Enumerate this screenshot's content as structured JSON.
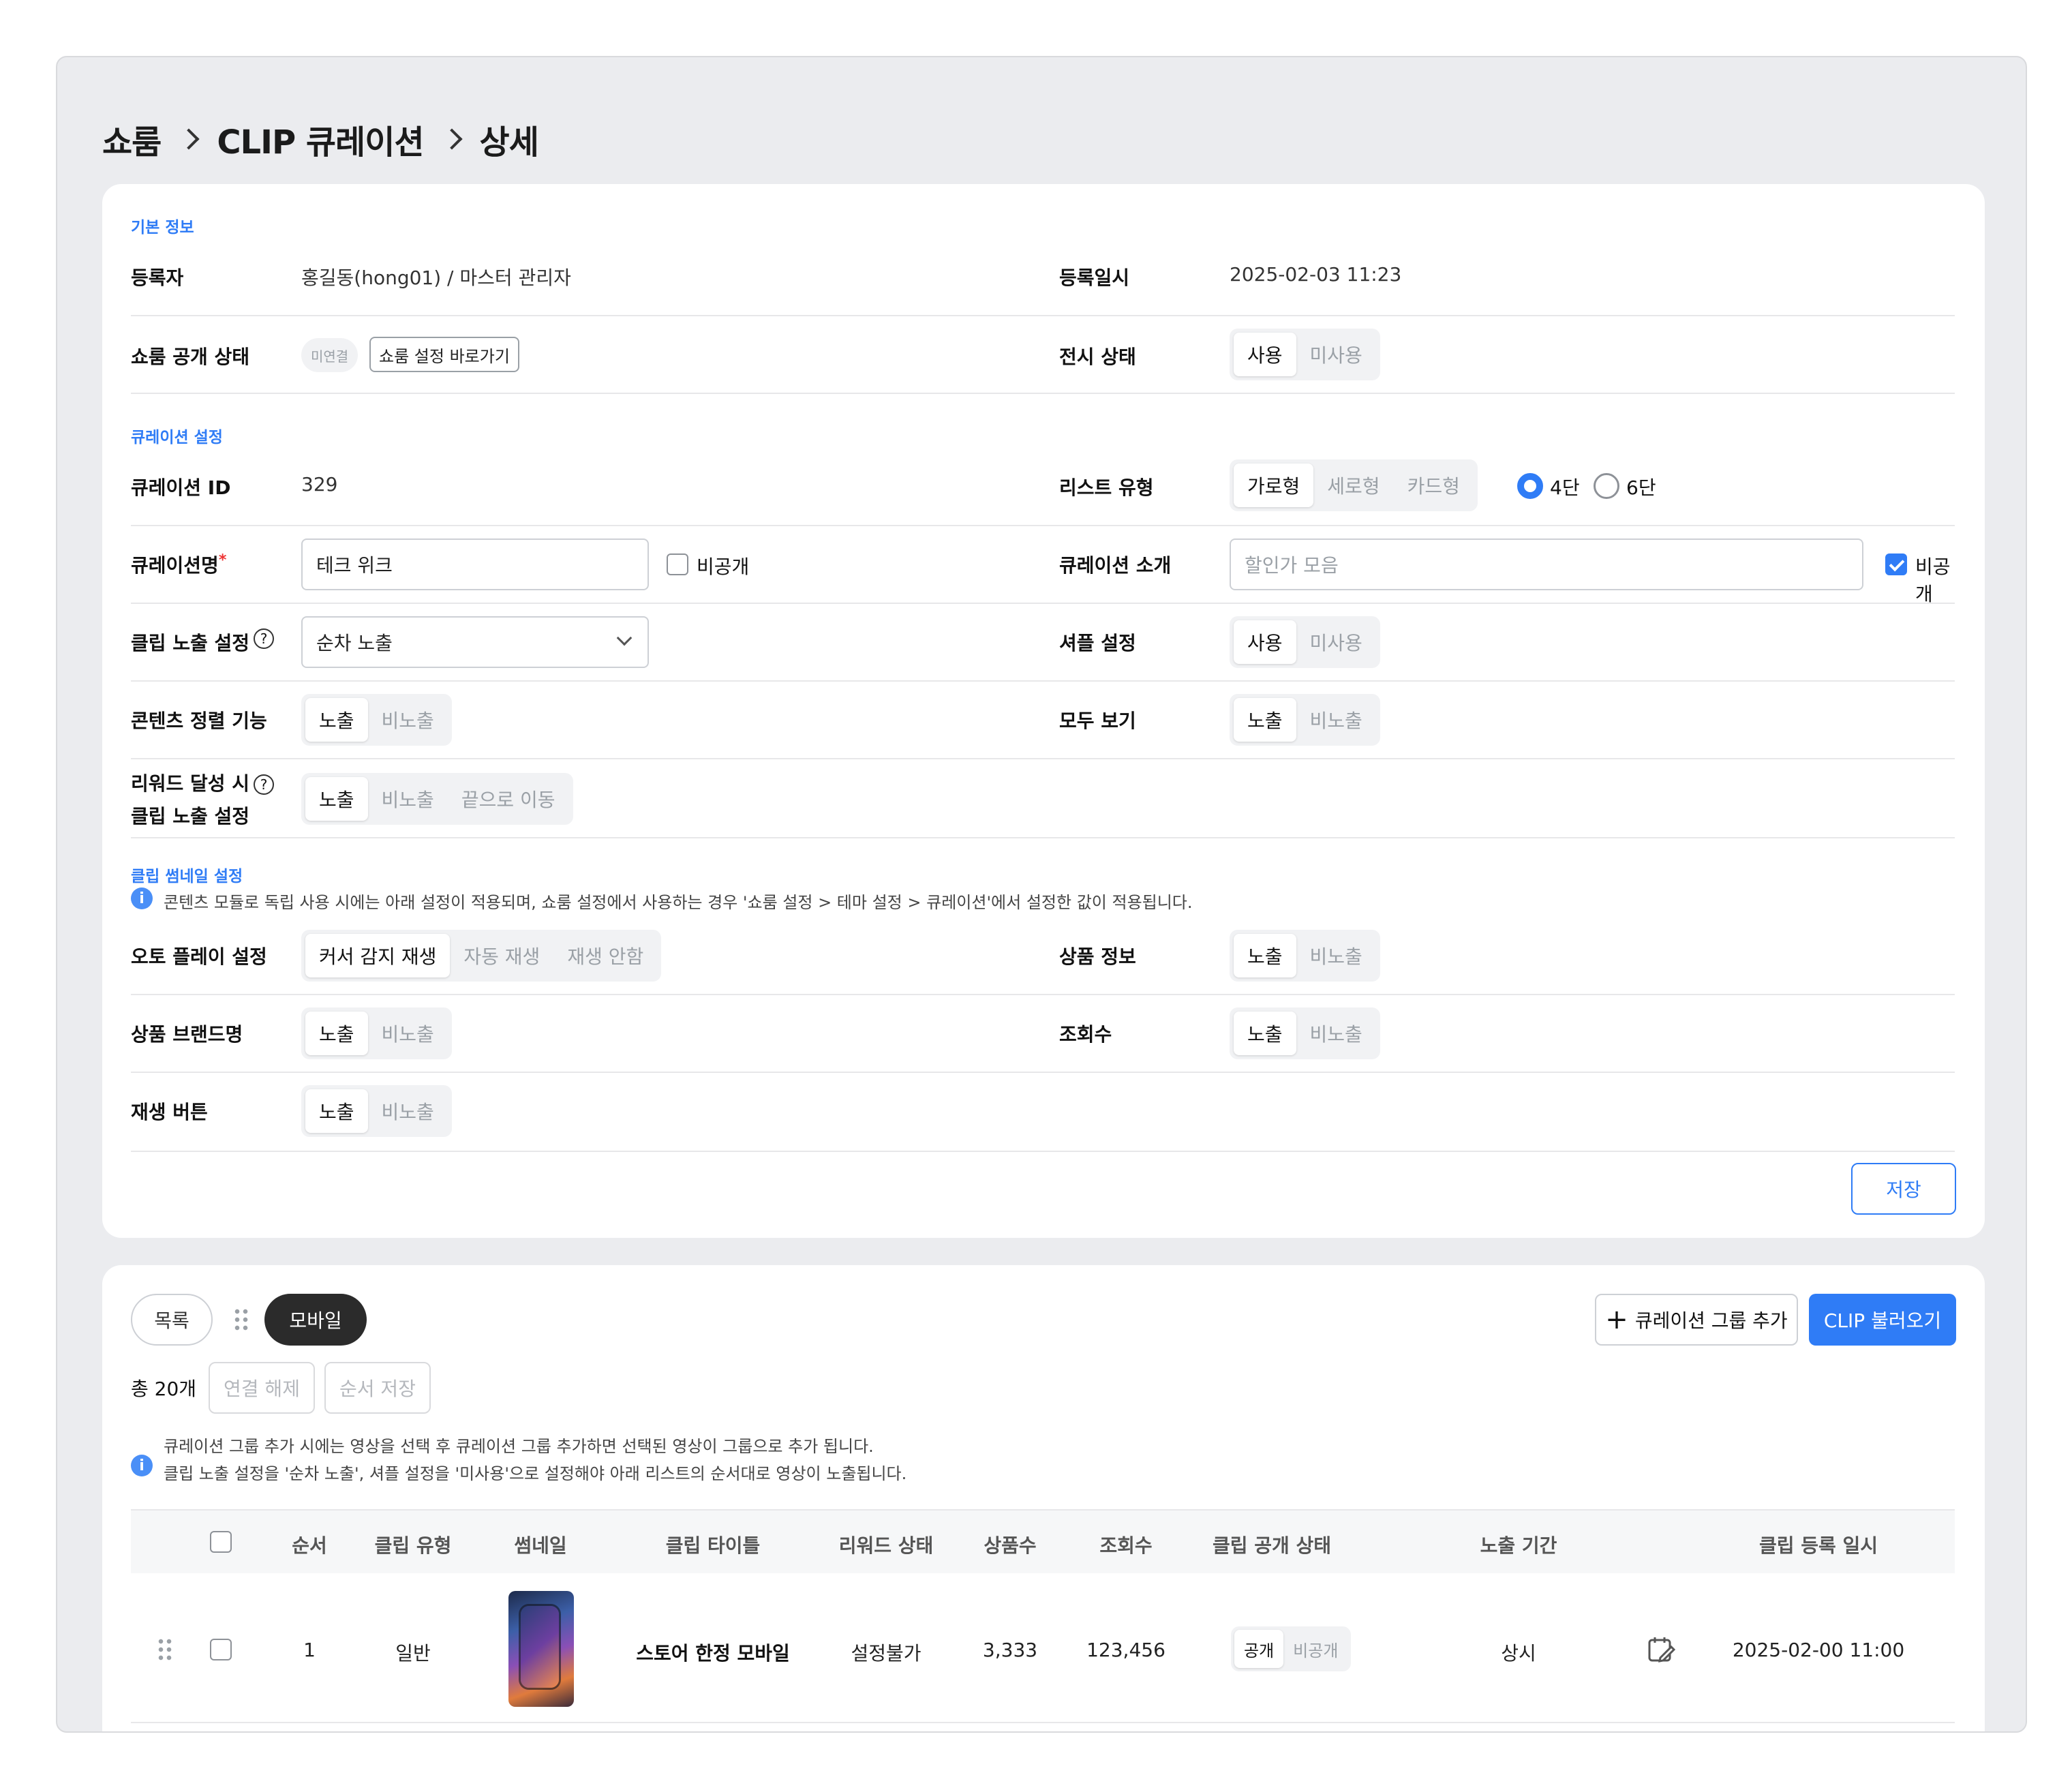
{
  "breadcrumb": {
    "items": [
      "쇼룸",
      "CLIP 큐레이션",
      "상세"
    ]
  },
  "basic": {
    "title": "기본 정보",
    "registrant_label": "등록자",
    "registrant_value": "홍길동(hong01) / 마스터 관리자",
    "regdate_label": "등록일시",
    "regdate_value": "2025-02-03 11:23",
    "showroom_status_label": "쇼룸 공개 상태",
    "showroom_status_badge": "미연결",
    "showroom_settings_link": "쇼룸 설정 바로가기",
    "display_status_label": "전시 상태",
    "display_status_options": [
      "사용",
      "미사용"
    ]
  },
  "curation": {
    "title": "큐레이션 설정",
    "id_label": "큐레이션 ID",
    "id_value": "329",
    "list_type_label": "리스트 유형",
    "list_type_options": [
      "가로형",
      "세로형",
      "카드형"
    ],
    "columns_options": [
      "4단",
      "6단"
    ],
    "columns_selected": "4단",
    "name_label": "큐레이션명",
    "required_mark": "*",
    "name_value": "테크 위크",
    "name_private_label": "비공개",
    "name_private_checked": false,
    "intro_label": "큐레이션 소개",
    "intro_placeholder": "할인가 모음",
    "intro_private_label": "비공개",
    "intro_private_checked": true,
    "clip_exposure_label": "클립 노출 설정",
    "clip_exposure_value": "순차 노출",
    "shuffle_label": "셔플 설정",
    "shuffle_options": [
      "사용",
      "미사용"
    ],
    "sort_label": "콘텐츠 정렬 기능",
    "sort_options": [
      "노출",
      "비노출"
    ],
    "viewall_label": "모두 보기",
    "viewall_options": [
      "노출",
      "비노출"
    ],
    "reward_label_1": "리워드 달성 시",
    "reward_label_2": "클립 노출 설정",
    "reward_options": [
      "노출",
      "비노출",
      "끝으로 이동"
    ]
  },
  "thumbnail": {
    "title": "클립 썸네일 설정",
    "info": "콘텐츠 모듈로 독립 사용 시에는 아래 설정이 적용되며, 쇼룸 설정에서 사용하는 경우 '쇼룸 설정 > 테마 설정 > 큐레이션'에서 설정한 값이 적용됩니다.",
    "autoplay_label": "오토 플레이 설정",
    "autoplay_options": [
      "커서 감지 재생",
      "자동 재생",
      "재생 안함"
    ],
    "product_info_label": "상품 정보",
    "product_info_options": [
      "노출",
      "비노출"
    ],
    "brand_label": "상품 브랜드명",
    "brand_options": [
      "노출",
      "비노출"
    ],
    "views_label": "조회수",
    "views_options": [
      "노출",
      "비노출"
    ],
    "play_label": "재생 버튼",
    "play_options": [
      "노출",
      "비노출"
    ],
    "save_button": "저장"
  },
  "list": {
    "tab_list": "목록",
    "tab_mobile": "모바일",
    "add_group_button": "큐레이션 그룹 추가",
    "load_clip_button": "CLIP 불러오기",
    "total": "총 20개",
    "unlink_button": "연결 해제",
    "save_order_button": "순서 저장",
    "info_1": "큐레이션 그룹 추가 시에는 영상을 선택 후 큐레이션 그룹 추가하면 선택된 영상이 그룹으로 추가 됩니다.",
    "info_2": "클립 노출 설정을 '순차 노출', 셔플 설정을 '미사용'으로 설정해야 아래 리스트의 순서대로 영상이 노출됩니다.",
    "columns": [
      "순서",
      "클립 유형",
      "썸네일",
      "클립 타이틀",
      "리워드 상태",
      "상품수",
      "조회수",
      "클립 공개 상태",
      "노출 기간",
      "클립 등록 일시"
    ],
    "rows": [
      {
        "order": "1",
        "type": "일반",
        "title": "스토어 한정 모바일",
        "reward": "설정불가",
        "products": "3,333",
        "views": "123,456",
        "public_options": [
          "공개",
          "비공개"
        ],
        "period": "상시",
        "date": "2025-02-00 11:00"
      }
    ]
  },
  "colors": {
    "accent": "#2f7cf6",
    "dark_pill": "#2b2b2b",
    "panel_bg": "#ebecef"
  }
}
